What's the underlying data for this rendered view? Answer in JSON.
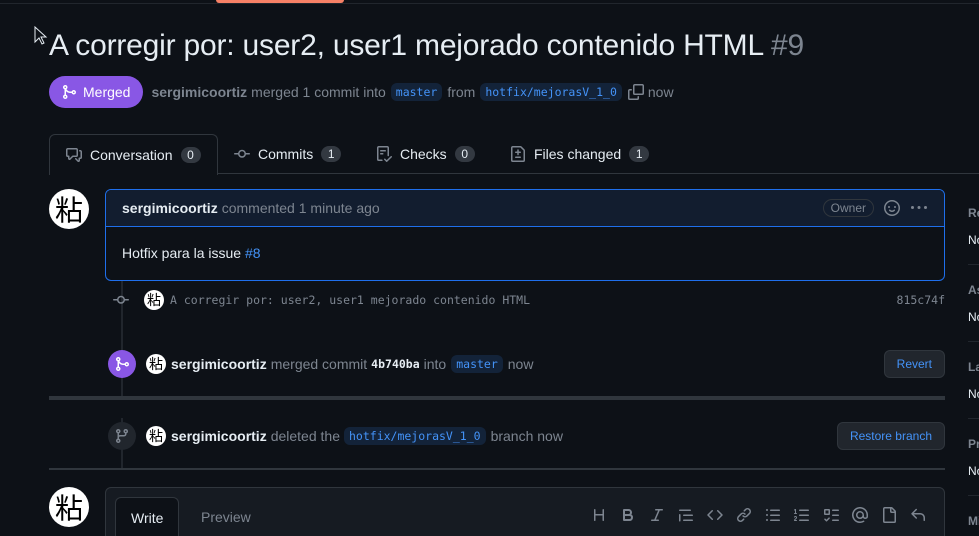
{
  "pr": {
    "title": "A corregir por: user2, user1 mejorado contenido HTML",
    "number": "#9",
    "state": "Merged",
    "author": "sergimicoortiz",
    "action_text": "merged 1 commit into",
    "base_branch": "master",
    "from_text": "from",
    "head_branch": "hotfix/mejorasV_1_0",
    "time": "now"
  },
  "tabs": [
    {
      "label": "Conversation",
      "count": "0",
      "icon": "comment-discussion-icon"
    },
    {
      "label": "Commits",
      "count": "1",
      "icon": "git-commit-icon"
    },
    {
      "label": "Checks",
      "count": "0",
      "icon": "checklist-icon"
    },
    {
      "label": "Files changed",
      "count": "1",
      "icon": "file-diff-icon"
    }
  ],
  "avatar_glyph": "粘",
  "comment": {
    "author": "sergimicoortiz",
    "action": "commented",
    "time": "1 minute ago",
    "role": "Owner",
    "body": "Hotfix para la issue",
    "issue_link": "#8"
  },
  "commit": {
    "message": "A corregir por: user2, user1 mejorado contenido HTML",
    "sha": "815c74f"
  },
  "merge_event": {
    "author": "sergimicoortiz",
    "action": "merged commit",
    "sha": "4b740ba",
    "into_text": "into",
    "branch": "master",
    "time": "now",
    "button": "Revert"
  },
  "delete_event": {
    "author": "sergimicoortiz",
    "action": "deleted the",
    "branch": "hotfix/mejorasV_1_0",
    "suffix": "branch now",
    "button": "Restore branch"
  },
  "editor": {
    "write_tab": "Write",
    "preview_tab": "Preview",
    "tools": [
      "heading-icon",
      "bold-icon",
      "italic-icon",
      "quote-icon",
      "code-icon",
      "link-icon",
      "unordered-list-icon",
      "ordered-list-icon",
      "task-list-icon",
      "mention-icon",
      "cross-reference-icon",
      "reply-icon"
    ]
  },
  "sidebar": [
    {
      "heading": "Reviewers",
      "value": "No reviews"
    },
    {
      "heading": "Assignees",
      "value": "No one assigned"
    },
    {
      "heading": "Labels",
      "value": "None yet"
    },
    {
      "heading": "Projects",
      "value": "None yet"
    },
    {
      "heading": "Milestone",
      "value": ""
    }
  ],
  "colors": {
    "background": "#0d1117",
    "merged": "#8957e5",
    "link": "#4493f8",
    "muted": "#7d8590",
    "accent_tab": "#f78166"
  }
}
